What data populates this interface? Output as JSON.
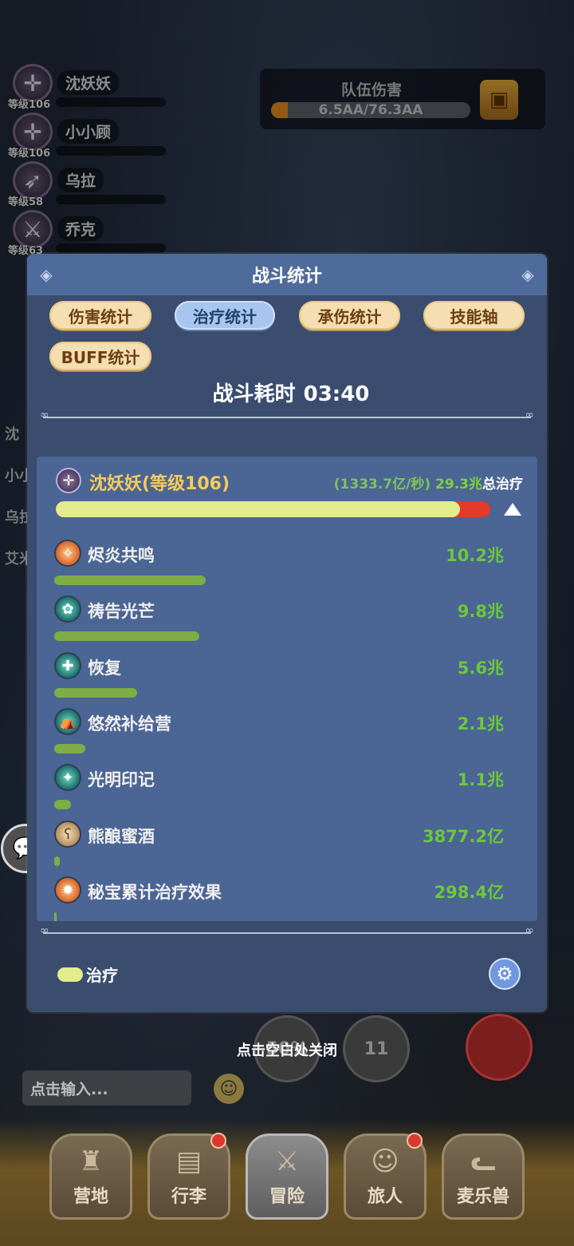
{
  "party": [
    {
      "name": "沈妖妖",
      "level": "等级106"
    },
    {
      "name": "小小顾",
      "level": "等级106"
    },
    {
      "name": "乌拉",
      "level": "等级58"
    },
    {
      "name": "乔克",
      "level": "等级63"
    }
  ],
  "team_damage": {
    "title": "队伍伤害",
    "value": "6.5AA/76.3AA",
    "progress": 0.085
  },
  "side_names": [
    "沈",
    "小小",
    "乌拉",
    "艾米"
  ],
  "dialog": {
    "title": "战斗统计",
    "tabs": [
      "伤害统计",
      "治疗统计",
      "承伤统计",
      "技能轴",
      "BUFF统计"
    ],
    "active_tab": "治疗统计",
    "duration_label": "战斗耗时",
    "duration_value": "03:40",
    "character": {
      "name": "沈妖妖(等级106)",
      "rate": "(1333.7亿/秒)",
      "total": "29.3兆",
      "total_label": "总治疗",
      "heal_fraction": 0.93
    },
    "skills": [
      {
        "name": "烬炎共鸣",
        "value": "10.2兆",
        "fraction": 0.348,
        "icon": "flame-resonance-icon"
      },
      {
        "name": "祷告光芒",
        "value": "9.8兆",
        "fraction": 0.334,
        "icon": "prayer-light-icon"
      },
      {
        "name": "恢复",
        "value": "5.6兆",
        "fraction": 0.191,
        "icon": "recovery-icon"
      },
      {
        "name": "悠然补给营",
        "value": "2.1兆",
        "fraction": 0.072,
        "icon": "supply-camp-icon"
      },
      {
        "name": "光明印记",
        "value": "1.1兆",
        "fraction": 0.038,
        "icon": "light-mark-icon"
      },
      {
        "name": "熊酿蜜酒",
        "value": "3877.2亿",
        "fraction": 0.013,
        "icon": "bear-mead-icon"
      },
      {
        "name": "秘宝累计治疗效果",
        "value": "298.4亿",
        "fraction": 0.001,
        "icon": "treasure-heal-icon"
      }
    ],
    "legend_label": "治疗"
  },
  "close_hint": "点击空白处关闭",
  "chat_placeholder": "点击输入...",
  "skill_buttons": [
    "50%",
    "11"
  ],
  "nav": [
    {
      "label": "营地",
      "badge": false
    },
    {
      "label": "行李",
      "badge": true
    },
    {
      "label": "冒险",
      "badge": false
    },
    {
      "label": "旅人",
      "badge": true
    },
    {
      "label": "麦乐兽",
      "badge": false
    }
  ],
  "colors": {
    "heal": "#e3ec8d",
    "bar_remainder": "#e33a2a",
    "skill_bar": "#7fac47",
    "value_green": "#6cc83a",
    "char_name": "#f3cc5b"
  }
}
